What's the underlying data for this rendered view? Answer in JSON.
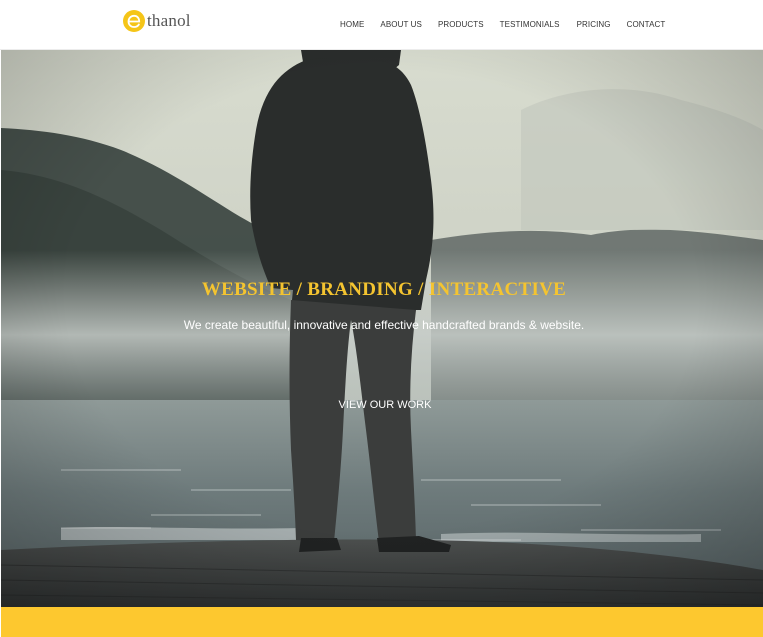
{
  "brand": {
    "logo_letter": "e",
    "name": "thanol",
    "accent_color": "#f5c518"
  },
  "nav": {
    "items": [
      {
        "label": "HOME"
      },
      {
        "label": "ABOUT US"
      },
      {
        "label": "PRODUCTS"
      },
      {
        "label": "TESTIMONIALS"
      },
      {
        "label": "PRICING"
      },
      {
        "label": "CONTACT"
      }
    ]
  },
  "hero": {
    "title": "WEBSITE / BRANDING / INTERACTIVE",
    "subtitle": "We create beautiful, innovative and effective handcrafted brands & website.",
    "cta_label": "VIEW OUR WORK",
    "title_color": "#f4c430",
    "background_image": "man-standing-on-pier-foggy-lake"
  },
  "footer_band": {
    "color": "#fdc82f"
  }
}
